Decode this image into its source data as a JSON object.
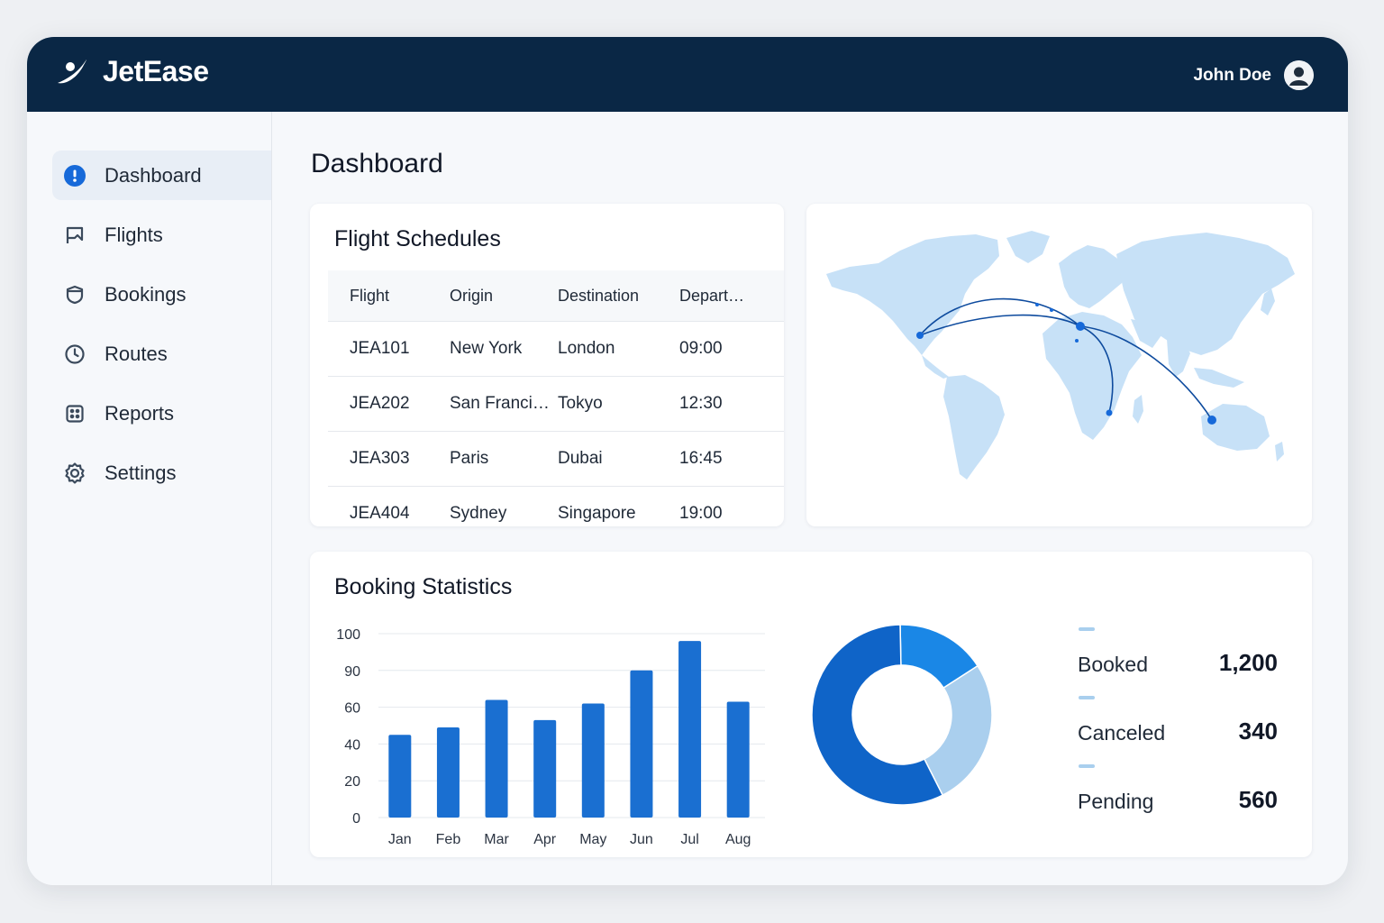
{
  "app": {
    "brand": "JetEase",
    "user_name": "John Doe"
  },
  "sidebar": {
    "items": [
      {
        "label": "Dashboard",
        "icon": "dashboard-icon",
        "active": true
      },
      {
        "label": "Flights",
        "icon": "flag-icon",
        "active": false
      },
      {
        "label": "Bookings",
        "icon": "shield-icon",
        "active": false
      },
      {
        "label": "Routes",
        "icon": "clock-icon",
        "active": false
      },
      {
        "label": "Reports",
        "icon": "grid-icon",
        "active": false
      },
      {
        "label": "Settings",
        "icon": "gear-icon",
        "active": false
      }
    ]
  },
  "page": {
    "title": "Dashboard"
  },
  "schedules": {
    "title": "Flight Schedules",
    "columns": [
      "Flight",
      "Origin",
      "Destination",
      "Depart…"
    ],
    "rows": [
      [
        "JEA101",
        "New York",
        "London",
        "09:00"
      ],
      [
        "JEA202",
        "San Franci…",
        "Tokyo",
        "12:30"
      ],
      [
        "JEA303",
        "Paris",
        "Dubai",
        "16:45"
      ],
      [
        "JEA404",
        "Sydney",
        "Singapore",
        "19:00"
      ]
    ]
  },
  "stats": {
    "title": "Booking Statistics",
    "legend": [
      {
        "label": "Booked",
        "value": "1,200"
      },
      {
        "label": "Canceled",
        "value": "340"
      },
      {
        "label": "Pending",
        "value": "560"
      }
    ]
  },
  "colors": {
    "nav": "#0a2745",
    "bar": "#1a6fd1",
    "donut_dark": "#0f64c8",
    "donut_mid": "#1a87e6",
    "donut_light": "#aacfee",
    "map_land": "#c7e1f7",
    "route": "#0e4b9e"
  },
  "chart_data": [
    {
      "type": "bar",
      "title": "",
      "categories": [
        "Jan",
        "Feb",
        "Mar",
        "Apr",
        "May",
        "Jun",
        "Jul",
        "Aug"
      ],
      "values": [
        45,
        49,
        64,
        53,
        62,
        80,
        96,
        63
      ],
      "y_ticks": [
        "0",
        "20",
        "40",
        "60",
        "90",
        "100"
      ],
      "ylim": [
        0,
        100
      ],
      "grid": true
    },
    {
      "type": "pie",
      "donut": true,
      "labels": [
        "Booked",
        "Canceled",
        "Pending"
      ],
      "values": [
        1200,
        340,
        560
      ]
    }
  ]
}
